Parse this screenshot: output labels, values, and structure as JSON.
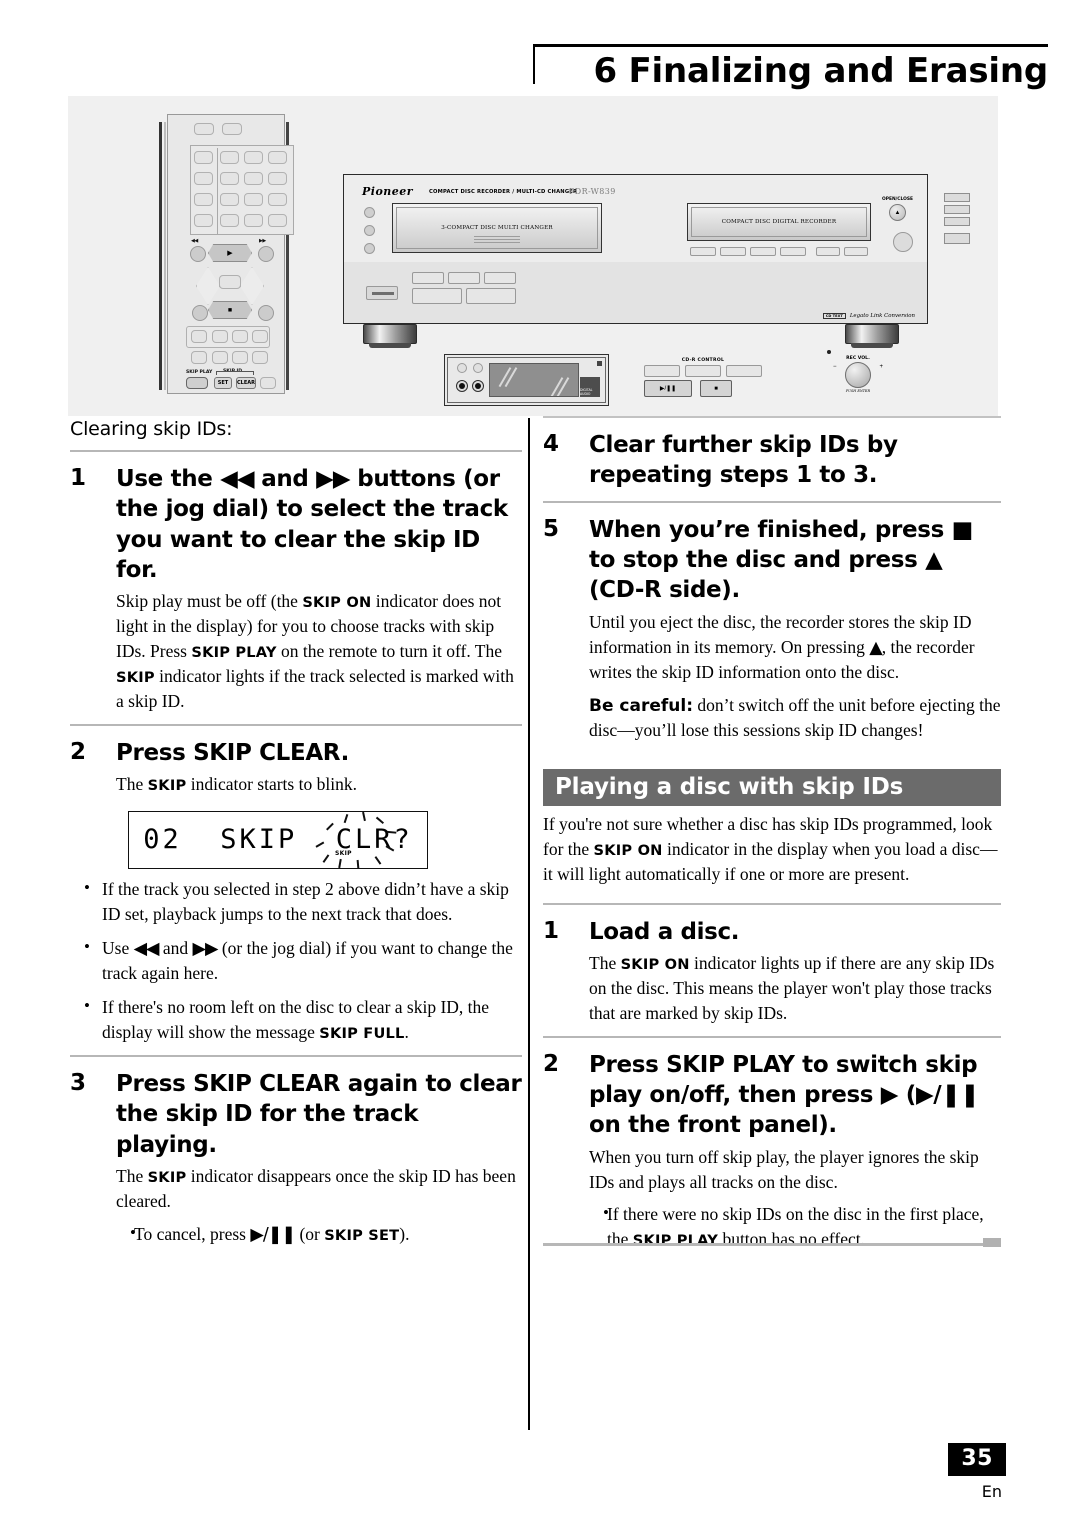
{
  "header": {
    "chapter_title": "6 Finalizing and Erasing"
  },
  "illustration": {
    "remote": {
      "skip_play_label": "SKIP PLAY",
      "skip_id_label": "SKIP ID",
      "set_label": "SET",
      "clear_label": "CLEAR",
      "prev_symbol": "◀◀",
      "next_symbol": "▶▶",
      "play_symbol": "▶",
      "stop_symbol": "■"
    },
    "unit": {
      "brand": "Pioneer",
      "brand_subtitle": "COMPACT DISC RECORDER / MULTI-CD CHANGER",
      "model": "PDR-W839",
      "changer_tray_label": "3-COMPACT DISC MULTI CHANGER",
      "recorder_tray_label": "COMPACT DISC DIGITAL RECORDER",
      "open_close_label": "OPEN/CLOSE",
      "eject_symbol": "▲",
      "cdr_control_label": "CD-R CONTROL",
      "rec_vol_label": "REC VOL.",
      "rec_vol_minus": "−",
      "rec_vol_plus": "+",
      "push_enter_label": "PUSH ENTER",
      "play_pause_symbol": "▶/❚❚",
      "stop_symbol": "■",
      "legato_badge": "CD TEXT",
      "legato_text": "Legato Link Conversion",
      "cd_logo_text": "DIGITAL AUDIO"
    }
  },
  "left_column": {
    "intro": "Clearing skip IDs:",
    "steps": [
      {
        "num": "1",
        "head_parts": [
          "Use the ",
          "◀◀",
          " and ",
          "▶▶",
          " buttons (or the jog dial) to select  the track you want to clear the skip ID for."
        ],
        "body_1": "Skip play must be off (the ",
        "body_sc_1": "SKIP ON",
        "body_2": " indicator does not light in the display) for you to choose tracks with skip IDs. Press ",
        "body_sc_2": "SKIP PLAY",
        "body_3": " on the remote to turn it off.  The ",
        "body_sc_3": "SKIP",
        "body_4": " indicator lights if the track selected is marked with a skip ID."
      },
      {
        "num": "2",
        "head": "Press SKIP CLEAR.",
        "body_1": "The ",
        "body_sc_1": "SKIP",
        "body_2": " indicator starts to blink.",
        "display": {
          "track": "02",
          "message_1": "SKIP",
          "message_2": "CLR?",
          "indicator": "SKIP"
        },
        "bullets": [
          {
            "t1": "If the track you selected in step 2 above didn’t have a skip ID set, playback jumps to the next track that does."
          },
          {
            "t1": "Use ",
            "sym1": "◀◀",
            "t2": " and ",
            "sym2": "▶▶",
            "t3": " (or the jog dial) if you want to change the track again here."
          },
          {
            "t1": "If there's no room left on the disc to clear a skip ID, the display will show the message ",
            "sc1": "SKIP FULL",
            "t2": "."
          }
        ]
      },
      {
        "num": "3",
        "head": "Press SKIP CLEAR again to clear the skip ID for the track playing.",
        "body_1": "The ",
        "body_sc_1": "SKIP",
        "body_2": " indicator disappears once the skip ID has been cleared.",
        "bullets": [
          {
            "t1": "To cancel, press ",
            "sym1": "▶/❚❚",
            "t2": " (or ",
            "sc1": "SKIP SET",
            "t3": ")."
          }
        ]
      }
    ]
  },
  "right_column": {
    "steps_top": [
      {
        "num": "4",
        "head": "Clear further skip IDs by repeating steps 1 to 3."
      },
      {
        "num": "5",
        "head_1": "When you’re finished, press ",
        "head_sym_1": "■",
        "head_2": " to stop the disc and press ",
        "head_sym_2": "▲",
        "head_3": " (CD-R side).",
        "body_1": "Until you eject the disc, the recorder stores the skip ID information in its memory. On pressing ",
        "body_sym_1": "▲",
        "body_2": ", the recorder writes the skip ID information onto the disc.",
        "careful_label": "Be careful:",
        "careful_text": " don’t switch off the unit before ejecting the disc—you’ll lose this sessions skip ID changes!"
      }
    ],
    "section": {
      "banner": "Playing a disc with skip IDs",
      "intro_1": "If you're not sure whether a disc has skip IDs programmed, look for the ",
      "intro_sc_1": "SKIP ON",
      "intro_2": " indicator in the display when you load a disc—it will light automatically if one or more are present.",
      "steps": [
        {
          "num": "1",
          "head": "Load a disc.",
          "body_1": "The ",
          "body_sc_1": "SKIP ON",
          "body_2": " indicator lights up if there are any skip IDs on the disc. This means the player won't play those tracks that are marked by skip IDs."
        },
        {
          "num": "2",
          "head_1": "Press SKIP PLAY to switch skip play on/off, then press ",
          "head_sym_1": "▶",
          "head_2": " (",
          "head_sym_2": "▶/❚❚",
          "head_3": " on the front panel).",
          "body_1": "When you turn off skip play, the player ignores the skip IDs and plays all tracks on the disc.",
          "bullets": [
            {
              "t1": "If there were no skip IDs on the disc in the first place, the ",
              "sc1": "SKIP PLAY",
              "t2": " button has no effect."
            }
          ]
        }
      ]
    }
  },
  "footer": {
    "page_number": "35",
    "language": "En"
  },
  "colors": {
    "banner_bg": "#6b6b6b",
    "illustration_bg": "#f0f0f0",
    "rule": "#b7b7b7",
    "page_box": "#000000"
  }
}
